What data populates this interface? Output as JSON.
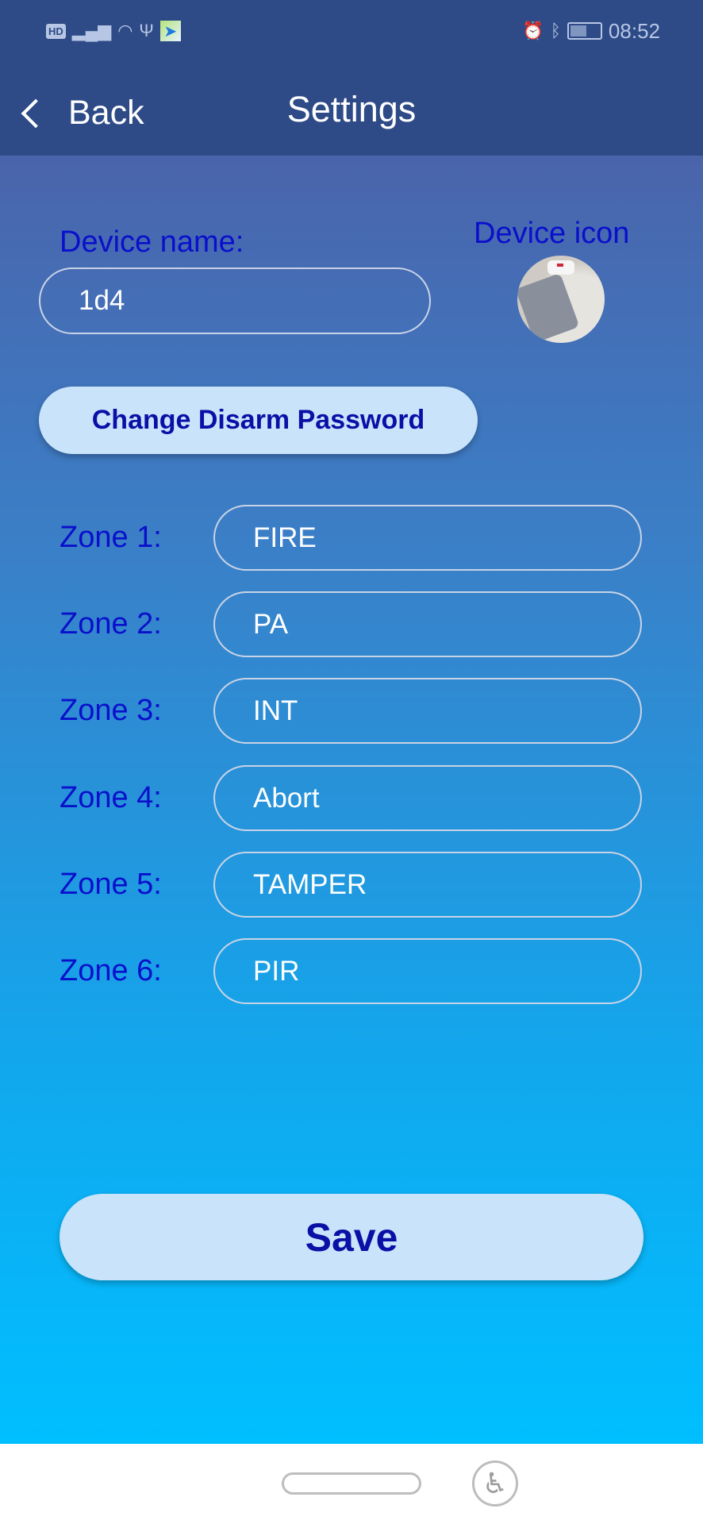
{
  "status_bar": {
    "time": "08:52",
    "left_icons": [
      "hd-icon",
      "4g-signal-icon",
      "wifi-icon",
      "usb-icon",
      "app-notification-icon"
    ],
    "right_icons": [
      "alarm-icon",
      "bluetooth-icon",
      "battery-charging-icon"
    ],
    "hd": "HD"
  },
  "header": {
    "back_label": "Back",
    "title": "Settings"
  },
  "device": {
    "name_label": "Device name:",
    "name_value": "1d4",
    "icon_label": "Device icon"
  },
  "change_password_label": "Change Disarm Password",
  "zones": [
    {
      "label": "Zone 1:",
      "value": "FIRE"
    },
    {
      "label": "Zone 2:",
      "value": "PA"
    },
    {
      "label": "Zone 3:",
      "value": "INT"
    },
    {
      "label": "Zone 4:",
      "value": "Abort"
    },
    {
      "label": "Zone 5:",
      "value": "TAMPER"
    },
    {
      "label": "Zone 6:",
      "value": "PIR"
    }
  ],
  "save_label": "Save",
  "colors": {
    "header": "#2e4b87",
    "label": "#0a0fcc",
    "button_bg": "#c9e3fb",
    "button_text": "#0a0fa6",
    "gradient_bottom": "#00bfff"
  }
}
